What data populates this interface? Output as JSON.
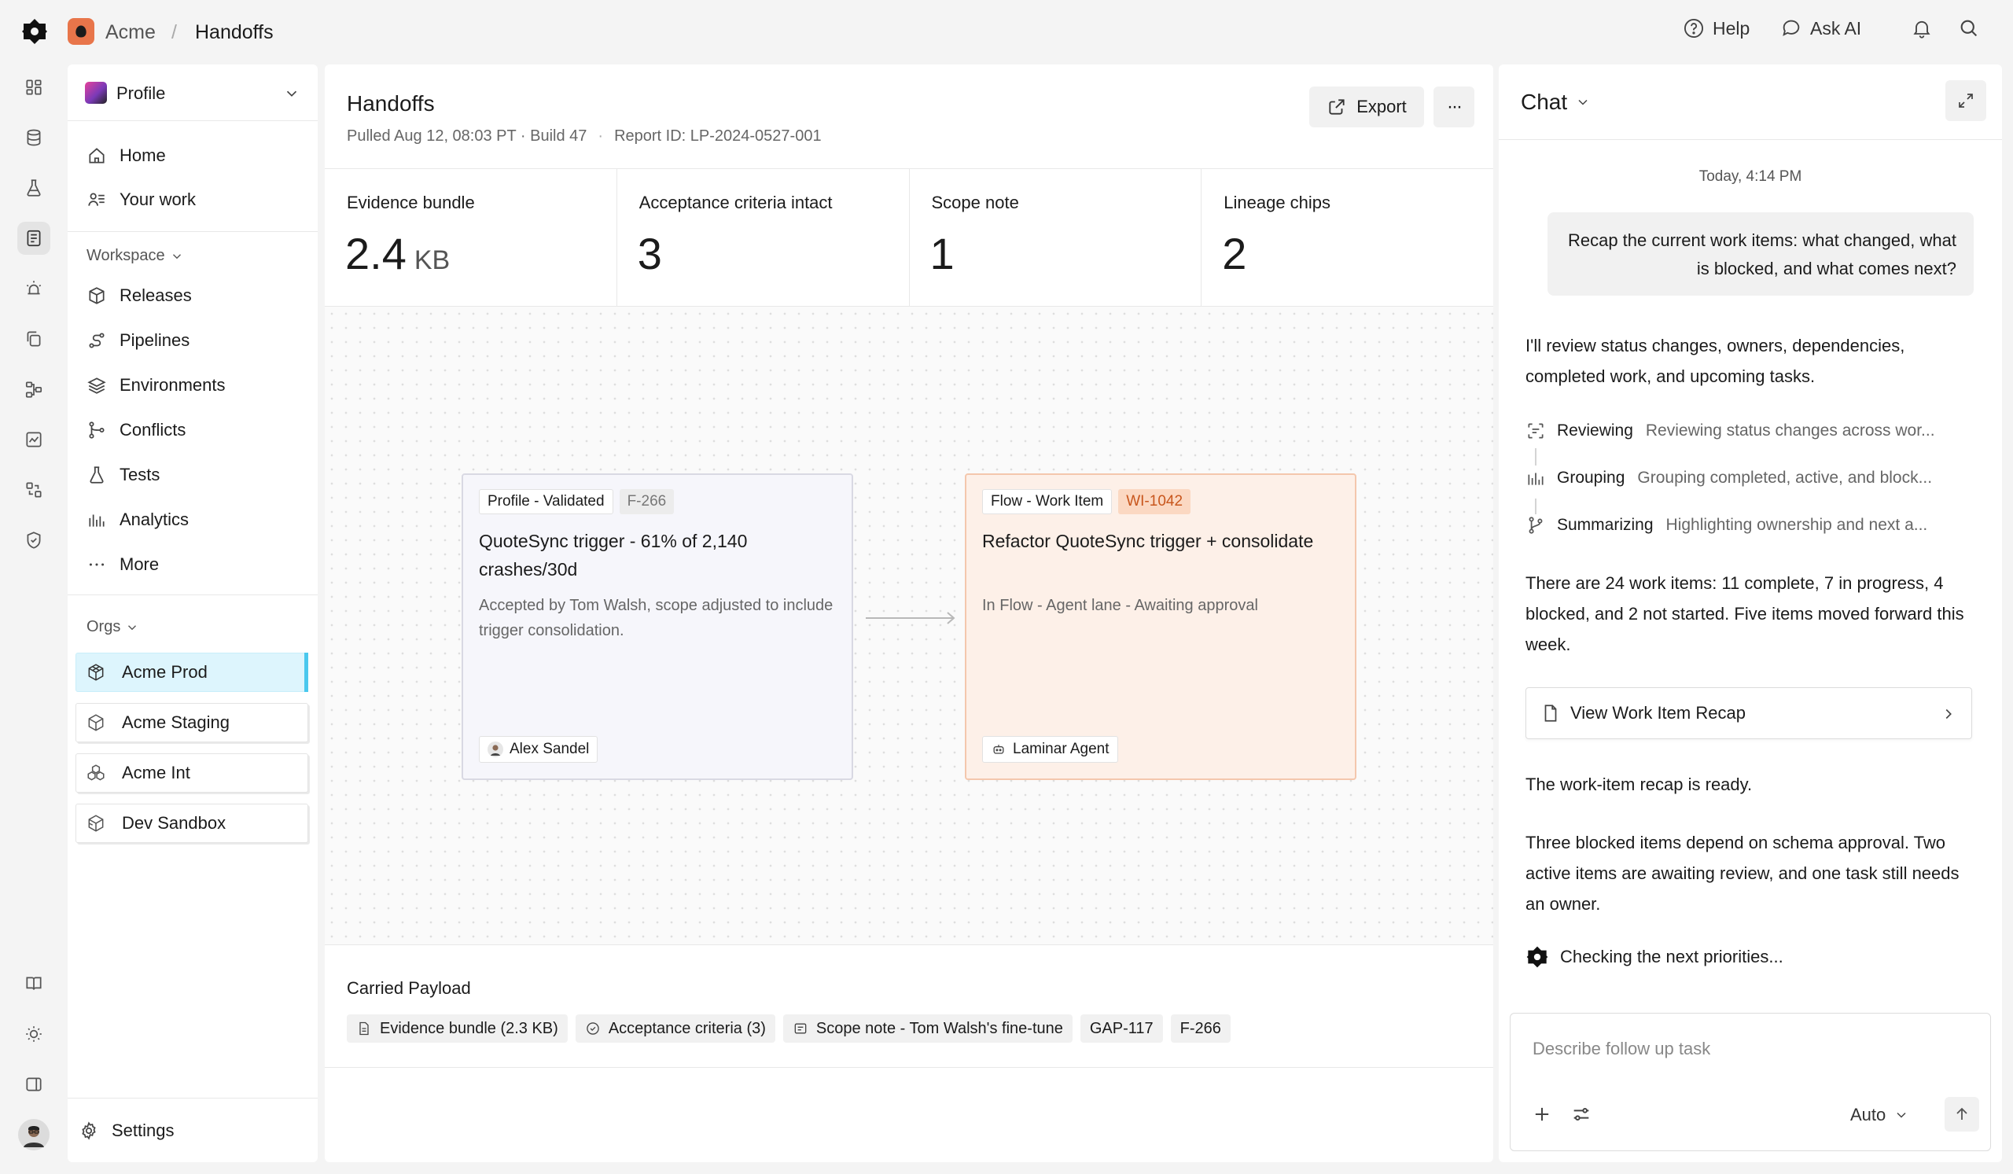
{
  "topbar": {
    "org": "Acme",
    "separator": "/",
    "page": "Handoffs",
    "help_label": "Help",
    "ask_ai_label": "Ask AI"
  },
  "sidebar": {
    "profile_label": "Profile",
    "primary": [
      {
        "label": "Home",
        "icon": "home-icon"
      },
      {
        "label": "Your work",
        "icon": "list-user-icon"
      }
    ],
    "workspace_label": "Workspace",
    "workspace_items": [
      {
        "label": "Releases",
        "icon": "package-icon"
      },
      {
        "label": "Pipelines",
        "icon": "route-icon"
      },
      {
        "label": "Environments",
        "icon": "layers-icon"
      },
      {
        "label": "Conflicts",
        "icon": "merge-icon"
      },
      {
        "label": "Tests",
        "icon": "flask-icon"
      },
      {
        "label": "Analytics",
        "icon": "bars-icon"
      },
      {
        "label": "More",
        "icon": "dots-icon"
      }
    ],
    "orgs_label": "Orgs",
    "orgs": [
      {
        "label": "Acme Prod",
        "active": true
      },
      {
        "label": "Acme Staging",
        "active": false
      },
      {
        "label": "Acme Int",
        "active": false
      },
      {
        "label": "Dev Sandbox",
        "active": false
      }
    ],
    "settings_label": "Settings"
  },
  "main": {
    "title": "Handoffs",
    "pulled": "Pulled Aug 12, 08:03 PT · Build 47",
    "dot": "·",
    "report_id": "Report ID: LP-2024-0527-001",
    "export_label": "Export",
    "more_label": "···",
    "stats": [
      {
        "label": "Evidence bundle",
        "value": "2.4",
        "unit": "KB"
      },
      {
        "label": "Acceptance criteria intact",
        "value": "3",
        "unit": ""
      },
      {
        "label": "Scope note",
        "value": "1",
        "unit": ""
      },
      {
        "label": "Lineage chips",
        "value": "2",
        "unit": ""
      }
    ],
    "card_left": {
      "chip": "Profile - Validated",
      "tag": "F-266",
      "title": "QuoteSync trigger - 61% of 2,140 crashes/30d",
      "desc": "Accepted by Tom Walsh, scope adjusted to include trigger consolidation.",
      "owner": "Alex Sandel"
    },
    "card_right": {
      "chip": "Flow - Work Item",
      "tag": "WI-1042",
      "title": "Refactor QuoteSync trigger + consolidate",
      "desc": "In Flow - Agent lane - Awaiting approval",
      "owner": "Laminar Agent"
    },
    "payload_title": "Carried Payload",
    "payload_chips": [
      "Evidence bundle (2.3 KB)",
      "Acceptance criteria (3)",
      "Scope note - Tom Walsh's fine-tune",
      "GAP-117",
      "F-266"
    ]
  },
  "chat": {
    "title": "Chat",
    "time": "Today, 4:14 PM",
    "user_message": "Recap the current work items: what changed, what is blocked, and what comes next?",
    "reply_intro": "I'll review status changes, owners, dependencies, completed work, and upcoming tasks.",
    "steps": [
      {
        "name": "Reviewing",
        "desc": "Reviewing status changes across wor..."
      },
      {
        "name": "Grouping",
        "desc": "Grouping completed, active, and block..."
      },
      {
        "name": "Summarizing",
        "desc": "Highlighting ownership and next a..."
      }
    ],
    "summary": "There are 24 work items: 11 complete, 7 in progress, 4 blocked, and 2 not started. Five items moved forward this week.",
    "recap_button": "View Work Item Recap",
    "recap_ready": "The work-item recap is ready.",
    "blocked_note": "Three blocked items depend on schema approval. Two active items are awaiting review, and one task still needs an owner.",
    "checking": "Checking the next priorities...",
    "input_placeholder": "Describe follow up task",
    "model_label": "Auto"
  }
}
